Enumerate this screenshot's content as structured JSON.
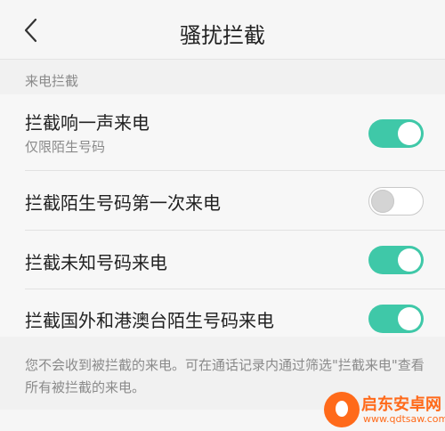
{
  "header": {
    "title": "骚扰拦截",
    "back_icon": "chevron-left-icon"
  },
  "section": {
    "label": "来电拦截"
  },
  "settings": [
    {
      "title": "拦截响一声来电",
      "subtitle": "仅限陌生号码",
      "enabled": true
    },
    {
      "title": "拦截陌生号码第一次来电",
      "enabled": false
    },
    {
      "title": "拦截未知号码来电",
      "enabled": true
    },
    {
      "title": "拦截国外和港澳台陌生号码来电",
      "enabled": true
    }
  ],
  "footnote": "您不会收到被拦截的来电。可在通话记录内通过筛选\"拦截来电\"查看所有被拦截的来电。",
  "watermark": {
    "name": "启东安卓网",
    "url": "www.qdtsaw.com"
  },
  "colors": {
    "toggle_on": "#3fc8a8",
    "toggle_off": "#d4d4d4",
    "watermark": "#ff6a1a"
  }
}
